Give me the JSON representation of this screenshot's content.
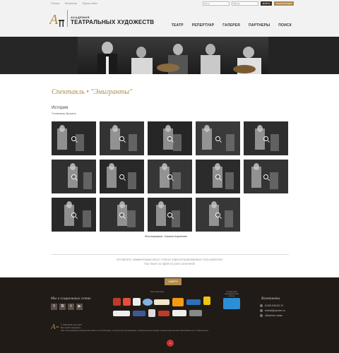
{
  "toplinks": [
    "Главная",
    "Контакты",
    "Карта сайта"
  ],
  "login": {
    "login_placeholder": "Логин",
    "password_placeholder": "Пароль",
    "login_btn": "ВОЙТИ",
    "register_btn": "РЕГИСТРАЦИЯ"
  },
  "logo": {
    "line1": "АКАДЕМИЯ",
    "line2": "ТЕАТРАЛЬНЫХ ХУДОЖЕСТВ"
  },
  "nav": [
    "ТЕАТР",
    "РЕПЕРТУАР",
    "ГАЛЕРЕЯ",
    "ПАРТНЕРЫ",
    "ПОИСК"
  ],
  "main": {
    "performance_title": "Спектакль • \"Эмигранты\"",
    "section_title": "История",
    "subtitle": "Славомир Мрожек",
    "photo_credit": "Фотографии: Сергея Карнеева",
    "comment_line1": "Оставлять комментарии могут только зарегистрированные пользователи",
    "comment_line2": "You have no rights to post comments"
  },
  "gallery_count": 14,
  "footer": {
    "up_label": "НАВЕРХ",
    "social_title": "Мы в социальных сетях",
    "social_icons": [
      "f",
      "В",
      "t",
      "▶"
    ],
    "partners_label": "Наши партнеры",
    "info_partner_label": "Генеральный информационный партнер",
    "contacts_title": "Контакты",
    "phone": "8-905-538-80-76",
    "email": "teatrat@yandex.ru",
    "feedback": "обратная связь",
    "copyright1": "© 1999-2016 Театр АТХ",
    "copyright2": "Все права защищены.",
    "copyright3": "При использовании материалов сайта в сети Интернет, а так-же при цитировании, в обязательном порядке гиперссылка на сайт www.theatre-atx.ru обязательна."
  },
  "colors": {
    "accent": "#b08a4f",
    "footer_bg": "#211b17",
    "header_bg": "#f2f2f2"
  }
}
